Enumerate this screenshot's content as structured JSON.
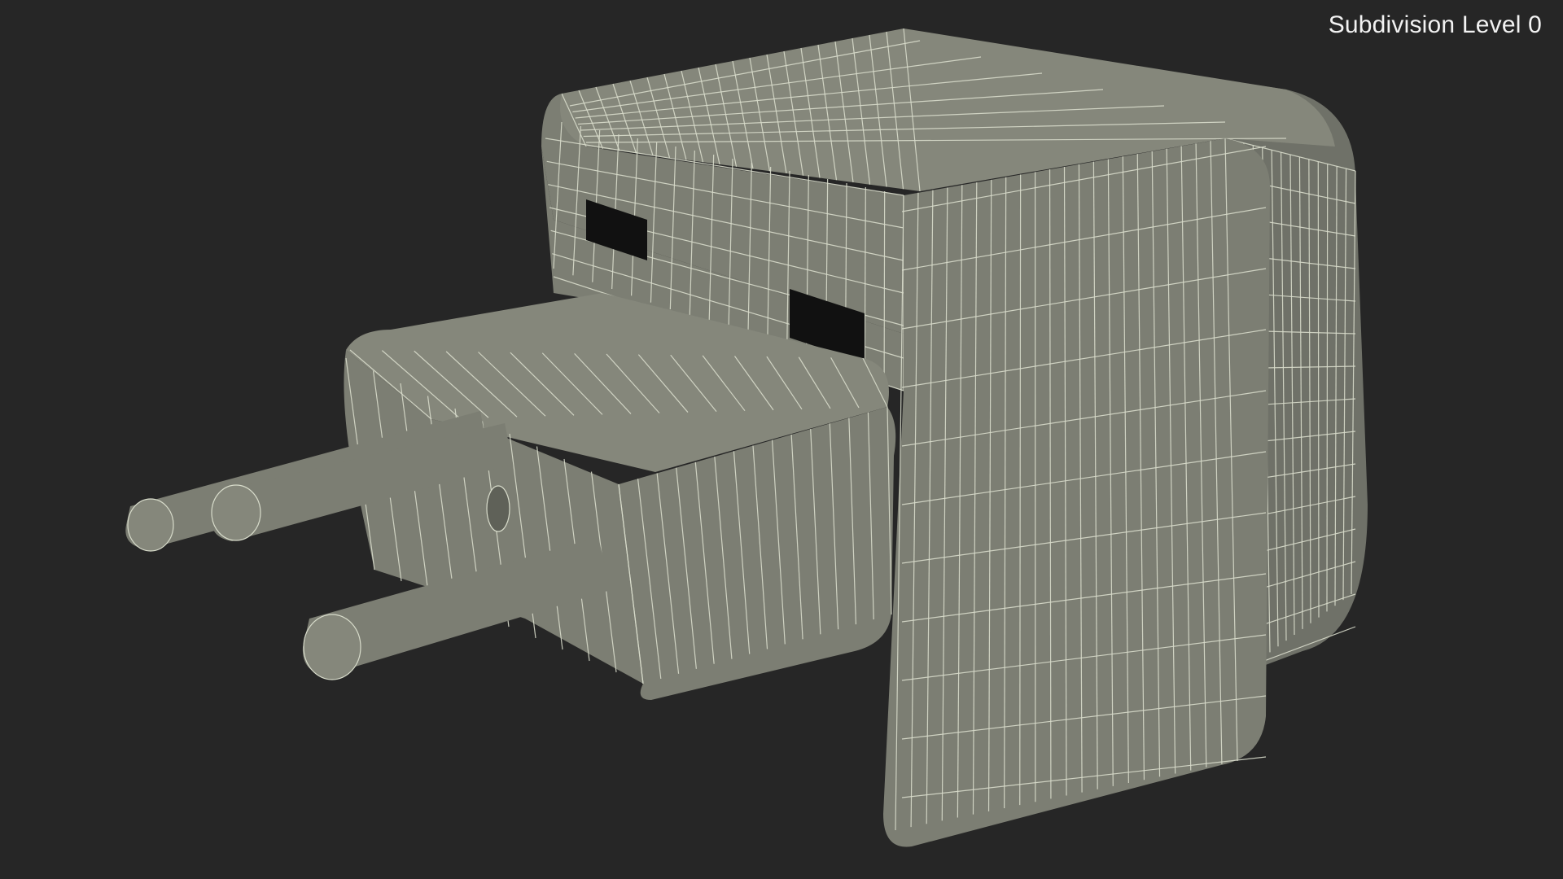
{
  "viewport": {
    "label": "Subdivision Level 0",
    "background_color": "#262626"
  },
  "model": {
    "surface_color": "#7c7e73",
    "wire_color": "#d8dccb"
  }
}
